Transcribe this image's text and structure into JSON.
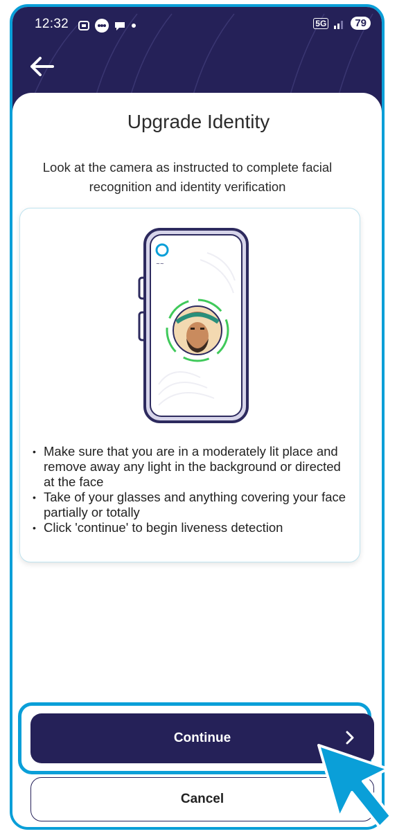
{
  "status_bar": {
    "time": "12:32",
    "left_icons": [
      "screenshot-icon",
      "app-notification-icon",
      "message-icon",
      "dot-icon"
    ],
    "network": "5G",
    "battery": "79"
  },
  "header": {
    "back_icon": "arrow-left-icon"
  },
  "main": {
    "title": "Upgrade Identity",
    "subtitle": "Look at the camera as instructed to complete facial recognition and identity verification",
    "instructions": [
      "Make sure that you are in a moderately lit place and remove away any light in the background or directed at the face",
      "Take of your glasses and anything covering your face partially or totally",
      "Click 'continue' to begin liveness detection"
    ]
  },
  "actions": {
    "continue_label": "Continue",
    "cancel_label": "Cancel"
  },
  "colors": {
    "primary": "#252158",
    "highlight": "#0a9fd8",
    "scan_ring": "#3fc95a"
  }
}
